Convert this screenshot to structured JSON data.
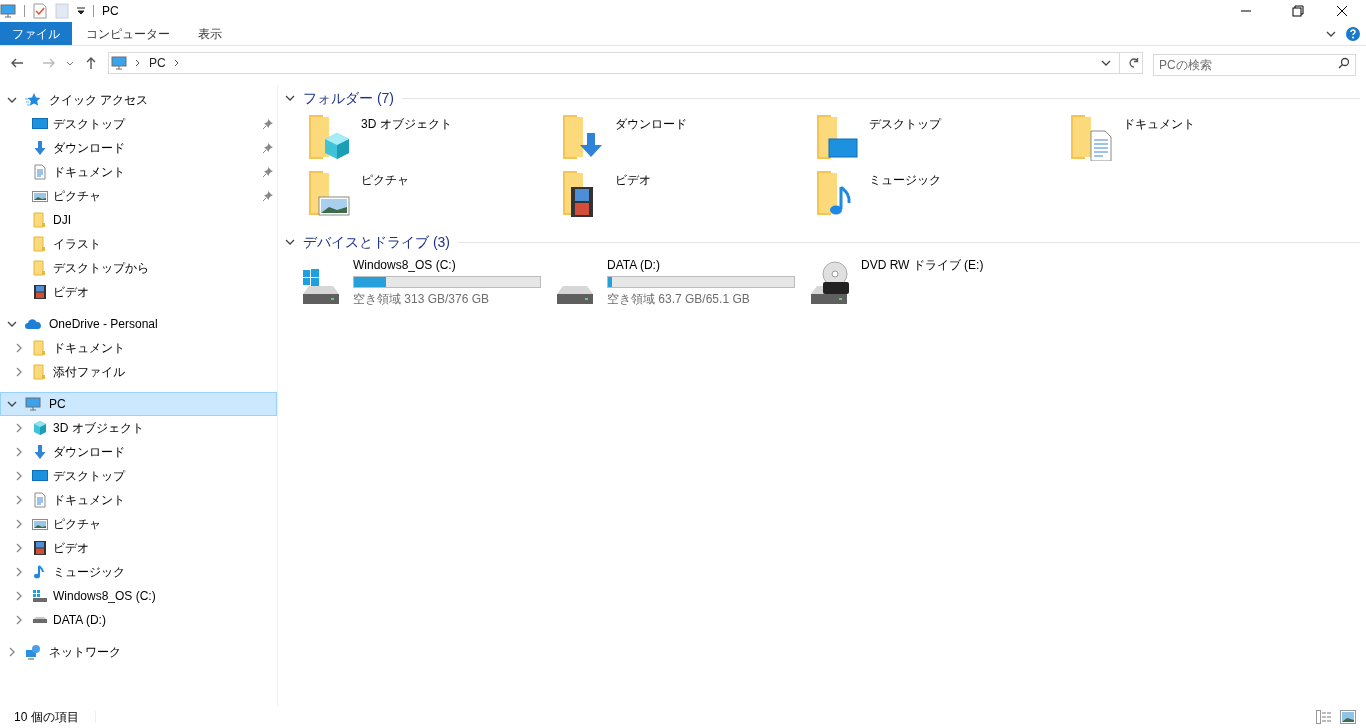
{
  "title_bar": {
    "title": "PC"
  },
  "ribbon": {
    "tabs": [
      {
        "label": "ファイル",
        "selected": true
      },
      {
        "label": "コンピューター",
        "selected": false
      },
      {
        "label": "表示",
        "selected": false
      }
    ]
  },
  "address": {
    "path": [
      "PC"
    ]
  },
  "search": {
    "placeholder": "PCの検索"
  },
  "sidebar": [
    {
      "label": "クイック アクセス",
      "kind": "star",
      "expanded": true,
      "selected": false,
      "children": [
        {
          "label": "デスクトップ",
          "kind": "desktop",
          "expandable": false,
          "pinned": true
        },
        {
          "label": "ダウンロード",
          "kind": "download",
          "expandable": false,
          "pinned": true
        },
        {
          "label": "ドキュメント",
          "kind": "document",
          "expandable": false,
          "pinned": true
        },
        {
          "label": "ピクチャ",
          "kind": "pictures",
          "expandable": false,
          "pinned": true
        },
        {
          "label": "DJI",
          "kind": "folder",
          "expandable": false,
          "pinned": false
        },
        {
          "label": "イラスト",
          "kind": "folder",
          "expandable": false,
          "pinned": false
        },
        {
          "label": "デスクトップから",
          "kind": "folder",
          "expandable": false,
          "pinned": false
        },
        {
          "label": "ビデオ",
          "kind": "video",
          "expandable": false,
          "pinned": false
        }
      ]
    },
    {
      "label": "OneDrive - Personal",
      "kind": "cloud",
      "expanded": true,
      "selected": false,
      "children": [
        {
          "label": "ドキュメント",
          "kind": "folder",
          "expandable": true,
          "pinned": false
        },
        {
          "label": "添付ファイル",
          "kind": "folder",
          "expandable": true,
          "pinned": false
        }
      ]
    },
    {
      "label": "PC",
      "kind": "pc",
      "expanded": true,
      "selected": true,
      "children": [
        {
          "label": "3D オブジェクト",
          "kind": "cube",
          "expandable": true,
          "pinned": false
        },
        {
          "label": "ダウンロード",
          "kind": "download",
          "expandable": true,
          "pinned": false
        },
        {
          "label": "デスクトップ",
          "kind": "desktop",
          "expandable": true,
          "pinned": false
        },
        {
          "label": "ドキュメント",
          "kind": "document",
          "expandable": true,
          "pinned": false
        },
        {
          "label": "ピクチャ",
          "kind": "pictures",
          "expandable": true,
          "pinned": false
        },
        {
          "label": "ビデオ",
          "kind": "video",
          "expandable": true,
          "pinned": false
        },
        {
          "label": "ミュージック",
          "kind": "music",
          "expandable": true,
          "pinned": false
        },
        {
          "label": "Windows8_OS (C:)",
          "kind": "drivewin",
          "expandable": true,
          "pinned": false
        },
        {
          "label": "DATA (D:)",
          "kind": "drive",
          "expandable": true,
          "pinned": false
        }
      ]
    },
    {
      "label": "ネットワーク",
      "kind": "network",
      "expanded": false,
      "selected": false
    }
  ],
  "folders": {
    "heading": "フォルダー (7)",
    "expanded": true,
    "items": [
      {
        "label": "3D オブジェクト",
        "kind": "cube"
      },
      {
        "label": "ダウンロード",
        "kind": "download"
      },
      {
        "label": "デスクトップ",
        "kind": "desktop"
      },
      {
        "label": "ドキュメント",
        "kind": "document"
      },
      {
        "label": "ピクチャ",
        "kind": "pictures"
      },
      {
        "label": "ビデオ",
        "kind": "video"
      },
      {
        "label": "ミュージック",
        "kind": "music"
      }
    ]
  },
  "drives": {
    "heading": "デバイスとドライブ (3)",
    "expanded": true,
    "items": [
      {
        "label": "Windows8_OS (C:)",
        "kind": "diskwin",
        "level": 0.17,
        "free": "空き領域 313 GB/376 GB"
      },
      {
        "label": "DATA (D:)",
        "kind": "disk",
        "level": 0.02,
        "free": "空き領域 63.7 GB/65.1 GB"
      },
      {
        "label": "DVD RW ドライブ (E:)",
        "kind": "dvd"
      }
    ]
  },
  "status_bar": {
    "count": "10 個の項目"
  }
}
